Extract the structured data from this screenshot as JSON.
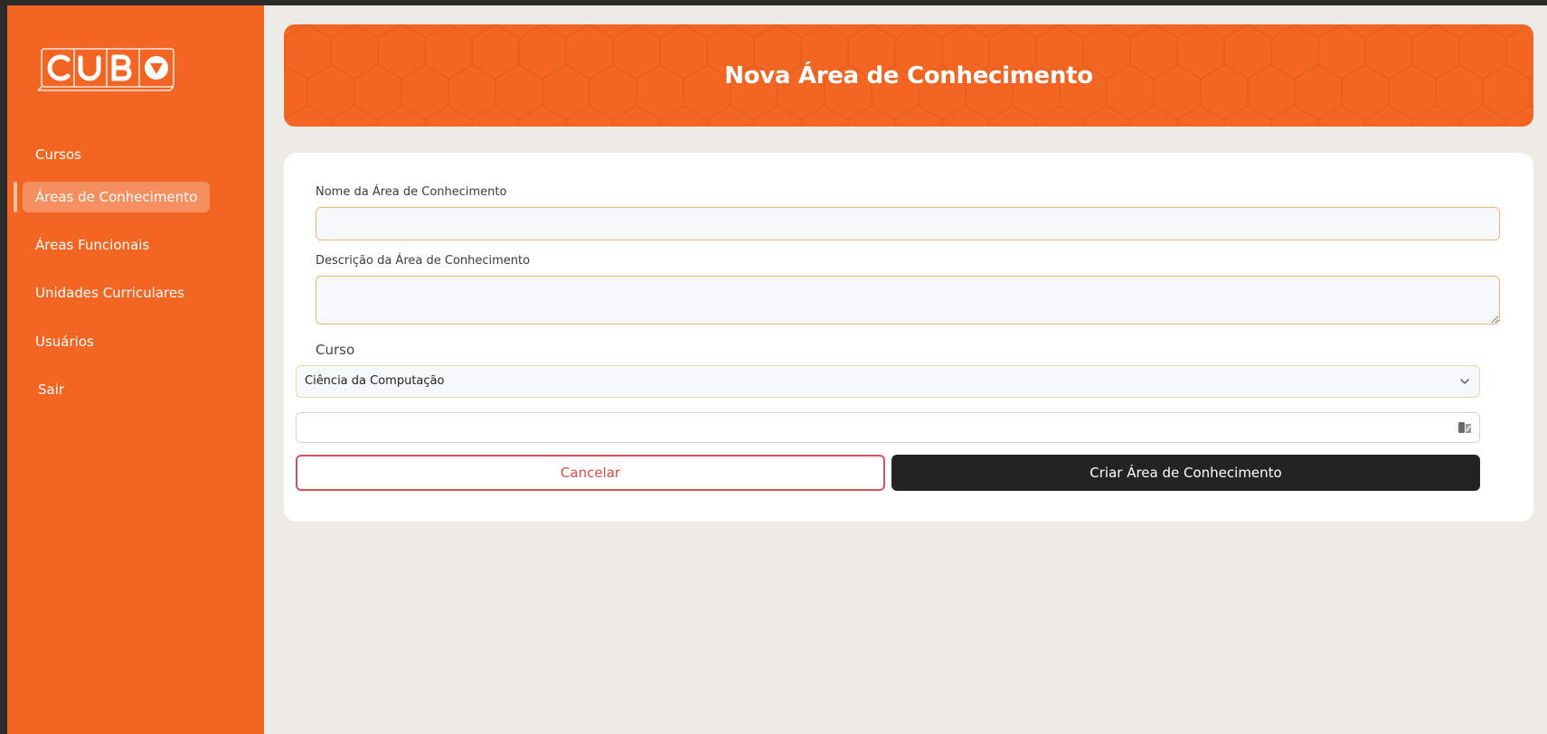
{
  "sidebar": {
    "logo_text": "CUBO",
    "items": [
      {
        "label": "Cursos"
      },
      {
        "label": "Áreas de Conhecimento",
        "active": true
      },
      {
        "label": "Áreas Funcionais"
      },
      {
        "label": "Unidades Curriculares"
      },
      {
        "label": "Usuários"
      },
      {
        "label": "Sair"
      }
    ]
  },
  "header": {
    "title": "Nova Área de Conhecimento"
  },
  "form": {
    "name_label": "Nome da Área de Conhecimento",
    "name_value": "",
    "description_label": "Descrição da Área de Conhecimento",
    "description_value": "",
    "course_label": "Curso",
    "course_selected": "Ciência da Computação",
    "file_value": "",
    "file_icon": "autofill-icon",
    "cancel_label": "Cancelar",
    "create_label": "Criar Área de Conhecimento"
  },
  "colors": {
    "brand_orange": "#f26522",
    "dark_button": "#232323",
    "cancel_red": "#d9505a",
    "page_bg": "#edebe6"
  }
}
